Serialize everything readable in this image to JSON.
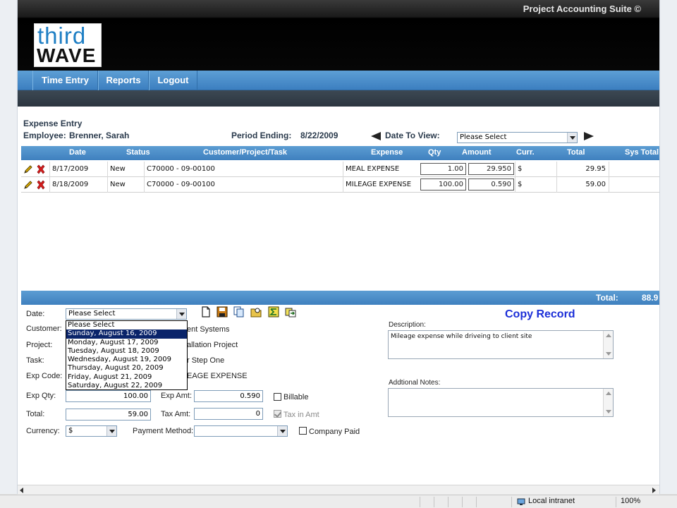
{
  "app": {
    "suite_title": "Project Accounting Suite ©",
    "logo_line1": "third",
    "logo_line2": "WAVE"
  },
  "nav": {
    "items": [
      {
        "label": "Time Entry"
      },
      {
        "label": "Reports"
      },
      {
        "label": "Logout"
      }
    ]
  },
  "header": {
    "title": "Expense Entry",
    "employee_label": "Employee:",
    "employee_value": "Brenner, Sarah",
    "period_label": "Period Ending:",
    "period_value": "8/22/2009",
    "date_to_view_label": "Date To View:",
    "date_to_view_value": "Please Select"
  },
  "grid": {
    "columns": [
      "Date",
      "Status",
      "Customer/Project/Task",
      "Expense",
      "Qty",
      "Amount",
      "Curr.",
      "Total",
      "Sys Total"
    ],
    "rows": [
      {
        "date": "8/17/2009",
        "status": "New",
        "cpt": "C70000 - 09-00100",
        "expense": "MEAL EXPENSE",
        "qty": "1.00",
        "amount": "29.950",
        "curr": "$",
        "total": "29.95",
        "sys_total": ""
      },
      {
        "date": "8/18/2009",
        "status": "New",
        "cpt": "C70000 - 09-00100",
        "expense": "MILEAGE EXPENSE",
        "qty": "100.00",
        "amount": "0.590",
        "curr": "$",
        "total": "59.00",
        "sys_total": ""
      }
    ],
    "total_label": "Total:",
    "total_value": "88.9"
  },
  "form": {
    "date_label": "Date:",
    "date_value": "Please Select",
    "customer_label": "Customer:",
    "customer_value_partial": "ent Systems",
    "project_label": "Project:",
    "project_value_partial": "allation Project",
    "task_label": "Task:",
    "task_value_partial": "r Step One",
    "exp_code_label": "Exp Code:",
    "exp_code_value_partial": "EAGE EXPENSE",
    "exp_qty_label": "Exp Qty:",
    "exp_qty_value": "100.00",
    "exp_amt_label": "Exp Amt:",
    "exp_amt_value": "0.590",
    "billable_label": "Billable",
    "total_label": "Total:",
    "total_value": "59.00",
    "tax_amt_label": "Tax Amt:",
    "tax_amt_value": "0",
    "tax_in_amt_label": "Tax in Amt",
    "currency_label": "Currency:",
    "currency_value": "$",
    "payment_method_label": "Payment Method:",
    "payment_method_value": "",
    "company_paid_label": "Company Paid",
    "copy_record_label": "Copy Record",
    "description_label": "Description:",
    "description_value": "Mileage expense while driveing to client site",
    "notes_label": "Addtional Notes:",
    "notes_value": ""
  },
  "date_dropdown": {
    "options": [
      "Please Select",
      "Sunday, August 16, 2009",
      "Monday, August 17, 2009",
      "Tuesday, August 18, 2009",
      "Wednesday, August 19, 2009",
      "Thursday, August 20, 2009",
      "Friday, August 21, 2009",
      "Saturday, August 22, 2009"
    ],
    "highlighted": "Sunday, August 16, 2009"
  },
  "statusbar": {
    "zone": "Local intranet",
    "zoom": "100%"
  },
  "colors": {
    "nav_blue": "#4a8dcb",
    "copy_record": "#1c2fd8",
    "dropdown_highlight": "#0a246a"
  },
  "icons": [
    "pencil-icon",
    "delete-x-icon",
    "new-doc-icon",
    "save-icon",
    "copy-icon",
    "folder-search-icon",
    "sum-icon",
    "export-icon"
  ]
}
